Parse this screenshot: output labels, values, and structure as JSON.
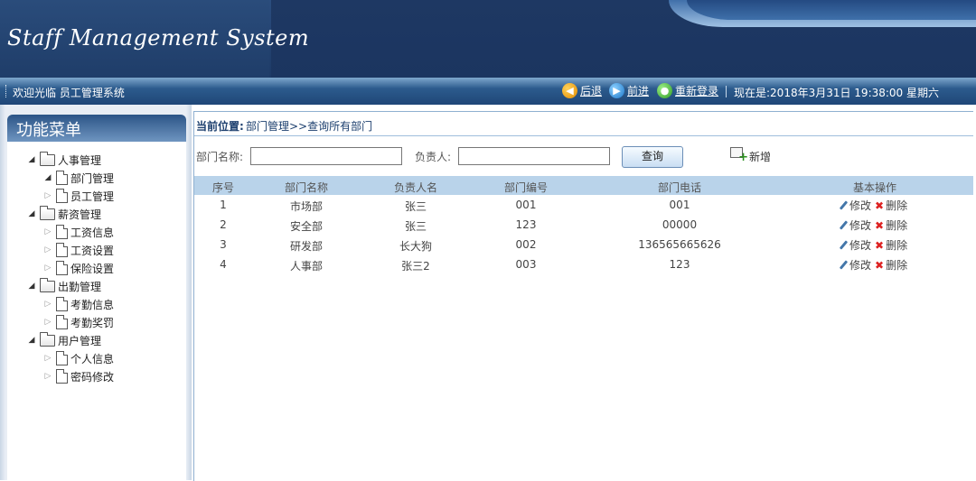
{
  "header": {
    "app_title": "Staff Management System"
  },
  "toolbar": {
    "welcome": "欢迎光临 员工管理系统",
    "back_label": "后退",
    "forward_label": "前进",
    "relogin_label": "重新登录",
    "now_text": "现在是:2018年3月31日 19:38:00 星期六"
  },
  "menu": {
    "title": "功能菜单",
    "groups": [
      {
        "label": "人事管理",
        "expanded": true,
        "items": [
          {
            "label": "部门管理",
            "expanded": true
          },
          {
            "label": "员工管理",
            "expanded": false
          }
        ]
      },
      {
        "label": "薪资管理",
        "expanded": true,
        "items": [
          {
            "label": "工资信息",
            "expanded": false
          },
          {
            "label": "工资设置",
            "expanded": false
          },
          {
            "label": "保险设置",
            "expanded": false
          }
        ]
      },
      {
        "label": "出勤管理",
        "expanded": true,
        "items": [
          {
            "label": "考勤信息",
            "expanded": false
          },
          {
            "label": "考勤奖罚",
            "expanded": false
          }
        ]
      },
      {
        "label": "用户管理",
        "expanded": true,
        "items": [
          {
            "label": "个人信息",
            "expanded": false
          },
          {
            "label": "密码修改",
            "expanded": false
          }
        ]
      }
    ]
  },
  "breadcrumb": {
    "prefix": "当前位置:",
    "path": "部门管理>>查询所有部门"
  },
  "search": {
    "dept_name_label": "部门名称:",
    "dept_name_value": "",
    "manager_label": "负责人:",
    "manager_value": "",
    "query_button": "查询",
    "add_label": "新增"
  },
  "table": {
    "columns": [
      "序号",
      "部门名称",
      "负责人名",
      "部门编号",
      "部门电话",
      "基本操作"
    ],
    "rows": [
      {
        "index": "1",
        "name": "市场部",
        "manager": "张三",
        "code": "001",
        "phone": "001"
      },
      {
        "index": "2",
        "name": "安全部",
        "manager": "张三",
        "code": "123",
        "phone": "00000"
      },
      {
        "index": "3",
        "name": "研发部",
        "manager": "长大狗",
        "code": "002",
        "phone": "136565665626"
      },
      {
        "index": "4",
        "name": "人事部",
        "manager": "张三2",
        "code": "003",
        "phone": "123"
      }
    ],
    "edit_label": "修改",
    "delete_label": "删除"
  }
}
